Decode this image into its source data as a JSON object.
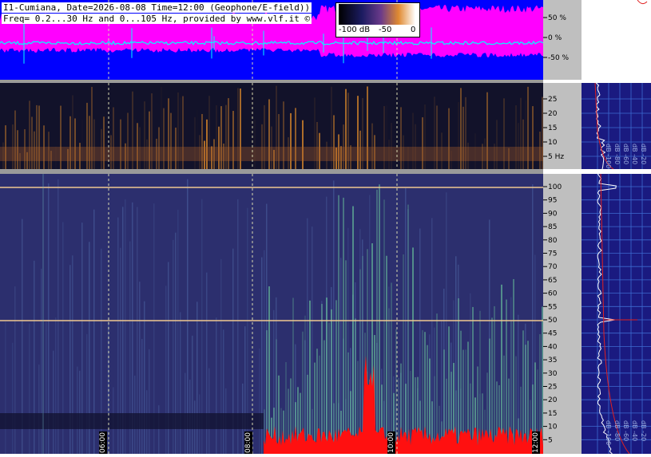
{
  "header": {
    "title_line1": "I1-Cumiana, Date=2026-08-08 Time=12:00 (Geophone/E-field))",
    "title_line2": "Freq= 0.2...30 Hz and 0...105 Hz, provided by www.vlf.it ©"
  },
  "db_scale": {
    "labels": [
      "-100 dB",
      "-50",
      "0"
    ]
  },
  "amplitude_axis": {
    "labels": [
      "50 %",
      "0 %",
      "-50 %"
    ]
  },
  "low_freq_axis": {
    "labels": [
      "25",
      "20",
      "15",
      "10",
      "5 Hz"
    ]
  },
  "high_freq_axis": {
    "labels": [
      "100",
      "95",
      "90",
      "85",
      "80",
      "75",
      "70",
      "65",
      "60",
      "55",
      "50",
      "45",
      "40",
      "35",
      "30",
      "25",
      "20",
      "15",
      "10",
      "5"
    ]
  },
  "time_labels": [
    "06:00",
    "08:00",
    "10:00",
    "12:00"
  ],
  "side_axis_labels": {
    "mid": [
      "dB -100",
      "dB -80",
      "dB -60",
      "dB -40",
      "dB -20"
    ],
    "low": [
      "dB -100",
      "dB -80",
      "dB -60",
      "dB -40",
      "dB -20"
    ]
  },
  "colors": {
    "top_bg": "#0000ff",
    "waveform_magenta": "#ff00ff",
    "waveform_cyan": "#00ffff",
    "spectrogram_dark": "#12122a",
    "spectrogram_blue": "#2c2f6e",
    "hot_orange": "#e8902a",
    "hot_red": "#ff1010",
    "axis_gray": "#bfbfbf"
  }
}
